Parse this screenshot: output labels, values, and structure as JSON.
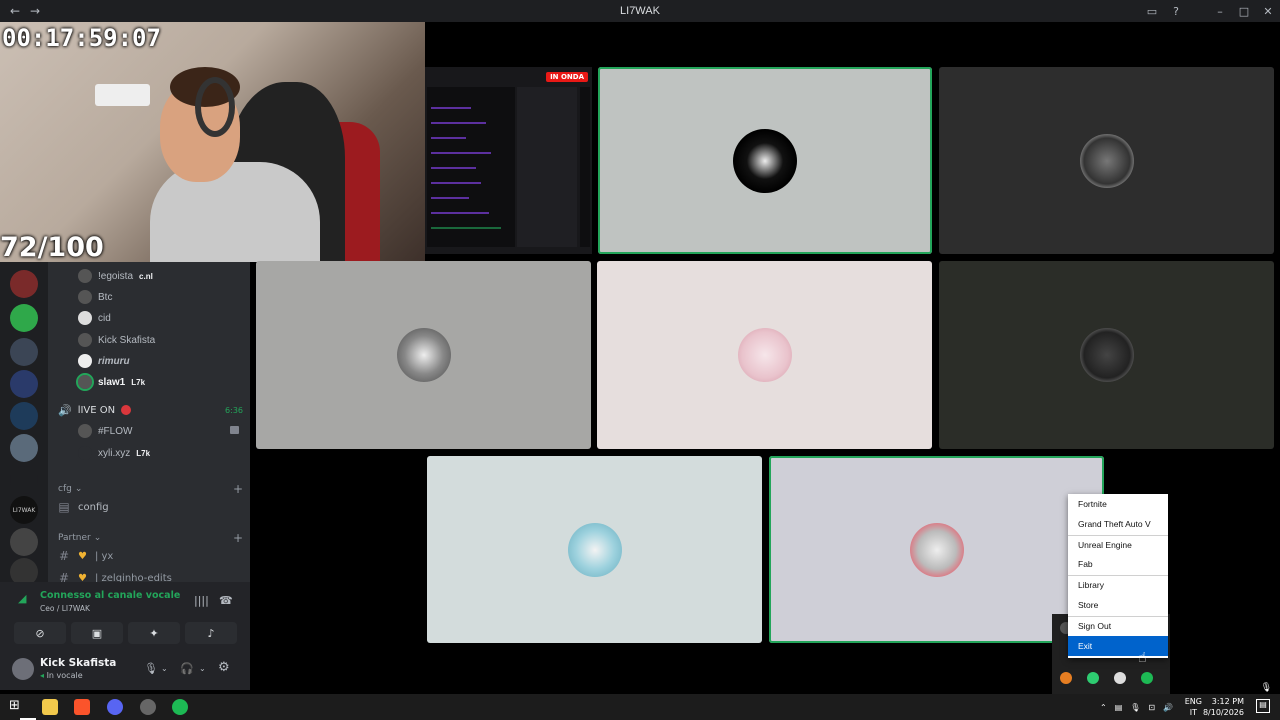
{
  "window": {
    "title": "LI7WAK"
  },
  "stream": {
    "timer": "00:17:59:07",
    "counter": "72/100",
    "live_badge": "IN ONDA"
  },
  "members": [
    {
      "name": "!egoista",
      "tag": "c.nl"
    },
    {
      "name": "Btc",
      "tag": ""
    },
    {
      "name": "cid",
      "tag": ""
    },
    {
      "name": "Kick Skafista",
      "tag": ""
    },
    {
      "name": "rimuru",
      "tag": ""
    },
    {
      "name": "slaw1",
      "tag": "L7k"
    }
  ],
  "voice_channel": {
    "name": "lIVE ON",
    "duration": "6:36",
    "members": [
      {
        "name": "#FLOW"
      },
      {
        "name": "xyli.xyz",
        "tag": "L7k"
      }
    ]
  },
  "categories": [
    {
      "name": "cfg",
      "channels": [
        {
          "name": "config"
        }
      ]
    },
    {
      "name": "Partner",
      "channels": [
        {
          "name": "| yx"
        },
        {
          "name": "| zelginho-edits"
        }
      ]
    }
  ],
  "voice_panel": {
    "status": "Connesso al canale vocale",
    "subtitle": "Ceo / LI7WAK"
  },
  "user": {
    "name": "Kick Skafista",
    "status": "In vocale"
  },
  "context_menu": {
    "items": [
      {
        "label": "Fortnite"
      },
      {
        "label": "Grand Theft Auto V"
      },
      {
        "label": "Unreal Engine"
      },
      {
        "label": "Fab"
      },
      {
        "label": "Library"
      },
      {
        "label": "Store"
      },
      {
        "label": "Sign Out"
      },
      {
        "label": "Exit"
      }
    ]
  },
  "taskbar": {
    "language": "ENG",
    "region": "IT",
    "time": "3:12 PM",
    "date": "8/10/2026"
  },
  "colors": {
    "accent_green": "#23a55a",
    "live_red": "#e91916",
    "menu_highlight": "#0063cc"
  }
}
